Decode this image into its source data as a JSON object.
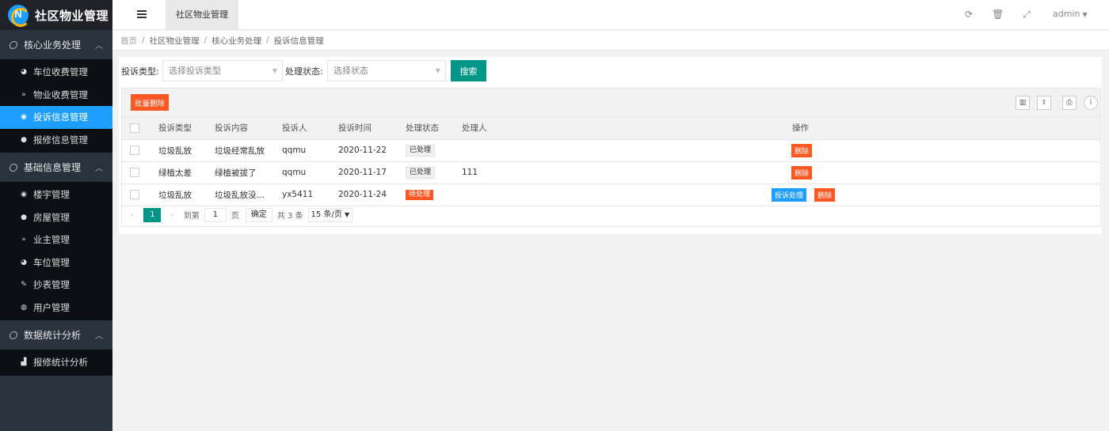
{
  "app": {
    "title": "社区物业管理"
  },
  "sidebar": {
    "groups": [
      {
        "label": "核心业务处理",
        "items": [
          {
            "label": "车位收费管理",
            "icon": "dashboard-icon"
          },
          {
            "label": "物业收费管理",
            "icon": "double-chevron-icon"
          },
          {
            "label": "投诉信息管理",
            "icon": "target-icon",
            "active": true
          },
          {
            "label": "报修信息管理",
            "icon": "compass-icon"
          }
        ]
      },
      {
        "label": "基础信息管理",
        "items": [
          {
            "label": "楼宇管理",
            "icon": "target-icon"
          },
          {
            "label": "房屋管理",
            "icon": "compass-icon"
          },
          {
            "label": "业主管理",
            "icon": "double-chevron-icon"
          },
          {
            "label": "车位管理",
            "icon": "dashboard-icon"
          },
          {
            "label": "抄表管理",
            "icon": "edit-icon"
          },
          {
            "label": "用户管理",
            "icon": "user-circle-icon"
          }
        ]
      },
      {
        "label": "数据统计分析",
        "items": [
          {
            "label": "报修统计分析",
            "icon": "area-chart-icon"
          }
        ]
      }
    ]
  },
  "header": {
    "tab": "社区物业管理",
    "user": "admin"
  },
  "breadcrumb": [
    "首页",
    "社区物业管理",
    "核心业务处理",
    "投诉信息管理"
  ],
  "filter": {
    "type_label": "投诉类型:",
    "type_placeholder": "选择投诉类型",
    "status_label": "处理状态:",
    "status_placeholder": "选择状态",
    "search_button": "搜索"
  },
  "toolbar": {
    "batch_delete": "批量删除"
  },
  "table": {
    "columns": [
      "投诉类型",
      "投诉内容",
      "投诉人",
      "投诉时间",
      "处理状态",
      "处理人",
      "操作"
    ],
    "rows": [
      {
        "type": "垃圾乱放",
        "content": "垃圾经常乱放",
        "person": "qqmu",
        "time": "2020-11-22",
        "status": "已处理",
        "handler": "",
        "actions": [
          "删除"
        ]
      },
      {
        "type": "绿植太差",
        "content": "绿植被拔了",
        "person": "qqmu",
        "time": "2020-11-17",
        "status": "已处理",
        "handler": "111",
        "actions": [
          "删除"
        ]
      },
      {
        "type": "垃圾乱放",
        "content": "垃圾乱放没…",
        "person": "yx5411",
        "time": "2020-11-24",
        "status": "待处理",
        "handler": "",
        "actions": [
          "投诉处理",
          "删除"
        ]
      }
    ]
  },
  "pager": {
    "current": "1",
    "goto_prefix": "到第",
    "goto_value": "1",
    "goto_suffix": "页",
    "confirm": "确定",
    "total": "共 3 条",
    "page_size": "15 条/页"
  },
  "colors": {
    "primary": "#009688",
    "accent": "#1E9FFF",
    "danger": "#FF5722",
    "sidebar": "#28333e"
  }
}
